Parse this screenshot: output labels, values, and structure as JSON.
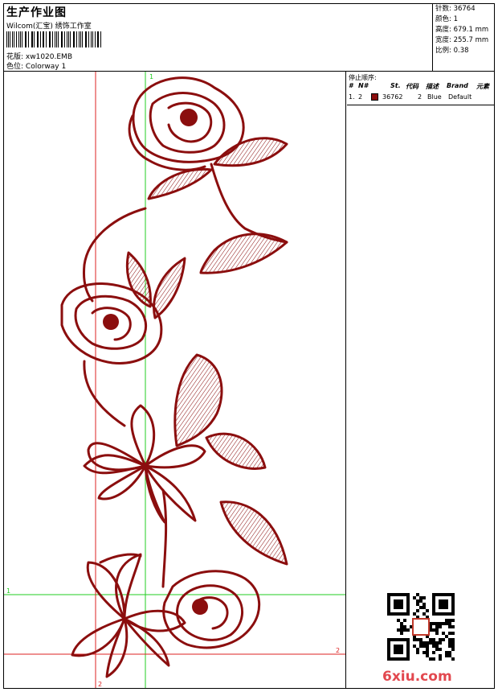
{
  "header": {
    "title": "生产作业图",
    "company": "Wilcom(汇宝) 绣饰工作室",
    "design_label": "花版:",
    "design_value": "xw1020.EMB",
    "colorway_label": "色位:",
    "colorway_value": "Colorway 1"
  },
  "specs": [
    {
      "label": "针数:",
      "value": "36764"
    },
    {
      "label": "颜色:",
      "value": "1"
    },
    {
      "label": "高度:",
      "value": "679.1 mm"
    },
    {
      "label": "宽度:",
      "value": "255.7 mm"
    },
    {
      "label": "比例:",
      "value": "0.38"
    }
  ],
  "stop_sequence": {
    "label": "停止顺序:",
    "columns": [
      "#",
      "N#",
      "St.",
      "代码",
      "描述",
      "Brand",
      "元素"
    ],
    "rows": [
      {
        "index": "1.",
        "needle": "2",
        "swatch_color": "#8b0e0e",
        "stitches": "36762",
        "code": "2",
        "desc": "Blue",
        "brand": "Default",
        "element": ""
      }
    ]
  },
  "guides": {
    "green_top_label": "1",
    "green_left_label": "1",
    "red_right_label": "2",
    "red_bottom_label": "2"
  },
  "colors": {
    "thread": "#8b0e0e",
    "guide_green": "#22cc22",
    "guide_red": "#dd2222",
    "watermark": "#e2484f"
  },
  "watermark": "6xiu.com"
}
